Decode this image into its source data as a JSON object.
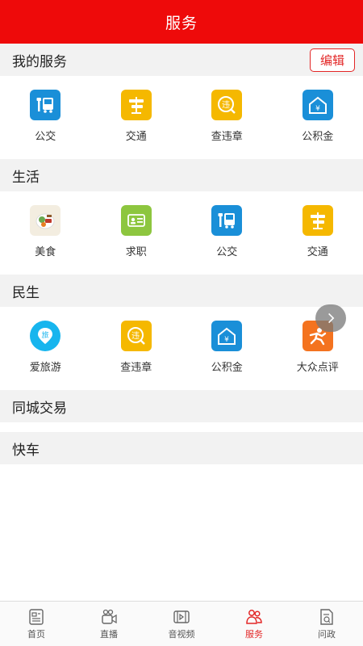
{
  "header": {
    "title": "服务"
  },
  "sections": {
    "my_services": {
      "label": "我的服务",
      "edit_label": "编辑",
      "items": [
        {
          "label": "公交",
          "icon": "bus-icon"
        },
        {
          "label": "交通",
          "icon": "road-sign-icon"
        },
        {
          "label": "查违章",
          "icon": "violation-icon"
        },
        {
          "label": "公积金",
          "icon": "housing-fund-icon"
        }
      ]
    },
    "life": {
      "label": "生活",
      "items": [
        {
          "label": "美食",
          "icon": "food-icon"
        },
        {
          "label": "求职",
          "icon": "job-card-icon"
        },
        {
          "label": "公交",
          "icon": "bus-icon"
        },
        {
          "label": "交通",
          "icon": "road-sign-icon"
        }
      ]
    },
    "livelihood": {
      "label": "民生",
      "items": [
        {
          "label": "爱旅游",
          "icon": "travel-icon"
        },
        {
          "label": "查违章",
          "icon": "violation-icon"
        },
        {
          "label": "公积金",
          "icon": "housing-fund-icon"
        },
        {
          "label": "大众点评",
          "icon": "dianping-icon"
        }
      ]
    },
    "local_trade": {
      "label": "同城交易"
    },
    "express": {
      "label": "快车"
    }
  },
  "tabbar": {
    "items": [
      {
        "label": "首页",
        "icon": "home-doc-icon"
      },
      {
        "label": "直播",
        "icon": "live-camera-icon"
      },
      {
        "label": "音视频",
        "icon": "video-icon"
      },
      {
        "label": "服务",
        "icon": "service-people-icon",
        "active": true
      },
      {
        "label": "问政",
        "icon": "inquiry-doc-icon"
      }
    ]
  },
  "colors": {
    "brand_red": "#ee0a0a",
    "bus_blue": "#1a8fd8",
    "sign_yellow": "#f5b800",
    "job_green": "#8dc63f",
    "travel_cyan": "#17b5ee",
    "dianping_orange": "#f4731f"
  }
}
